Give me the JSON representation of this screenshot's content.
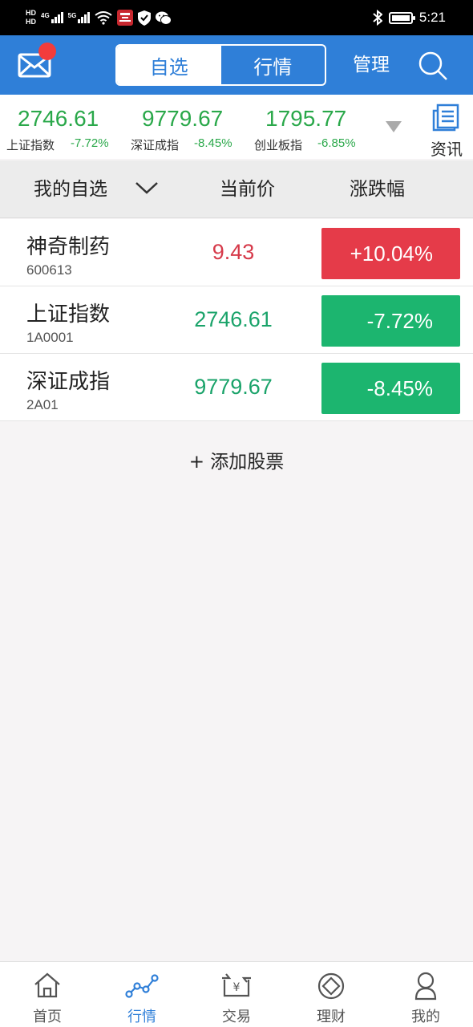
{
  "status_bar": {
    "hd_top": "HD",
    "hd_bottom": "HD",
    "net1": "4G",
    "net2": "5G",
    "time": "5:21"
  },
  "header": {
    "tabs": [
      {
        "label": "自选",
        "active": true
      },
      {
        "label": "行情",
        "active": false
      }
    ],
    "manage_label": "管理",
    "accent_color": "#2f7fd8",
    "badge_color": "#f23c3c"
  },
  "indices": [
    {
      "value": "2746.61",
      "name": "上证指数",
      "change": "-7.72%"
    },
    {
      "value": "9779.67",
      "name": "深证成指",
      "change": "-8.45%"
    },
    {
      "value": "1795.77",
      "name": "创业板指",
      "change": "-6.85%"
    }
  ],
  "news_label": "资讯",
  "list_header": {
    "watchlist": "我的自选",
    "price": "当前价",
    "change": "涨跌幅"
  },
  "stocks": [
    {
      "name": "神奇制药",
      "code": "600613",
      "price": "9.43",
      "change": "+10.04%",
      "price_color": "#d63a4a",
      "change_bg": "#e53b49"
    },
    {
      "name": "上证指数",
      "code": "1A0001",
      "price": "2746.61",
      "change": "-7.72%",
      "price_color": "#1aa36a",
      "change_bg": "#1cb56f"
    },
    {
      "name": "深证成指",
      "code": "2A01",
      "price": "9779.67",
      "change": "-8.45%",
      "price_color": "#1aa36a",
      "change_bg": "#1cb56f"
    }
  ],
  "add_stock_label": "+ 添加股票",
  "bottom_nav": [
    {
      "label": "首页",
      "icon": "home-icon",
      "active": false
    },
    {
      "label": "行情",
      "icon": "market-trend-icon",
      "active": true
    },
    {
      "label": "交易",
      "icon": "trade-yuan-icon",
      "active": false
    },
    {
      "label": "理财",
      "icon": "wealth-icon",
      "active": false
    },
    {
      "label": "我的",
      "icon": "user-icon",
      "active": false
    }
  ]
}
